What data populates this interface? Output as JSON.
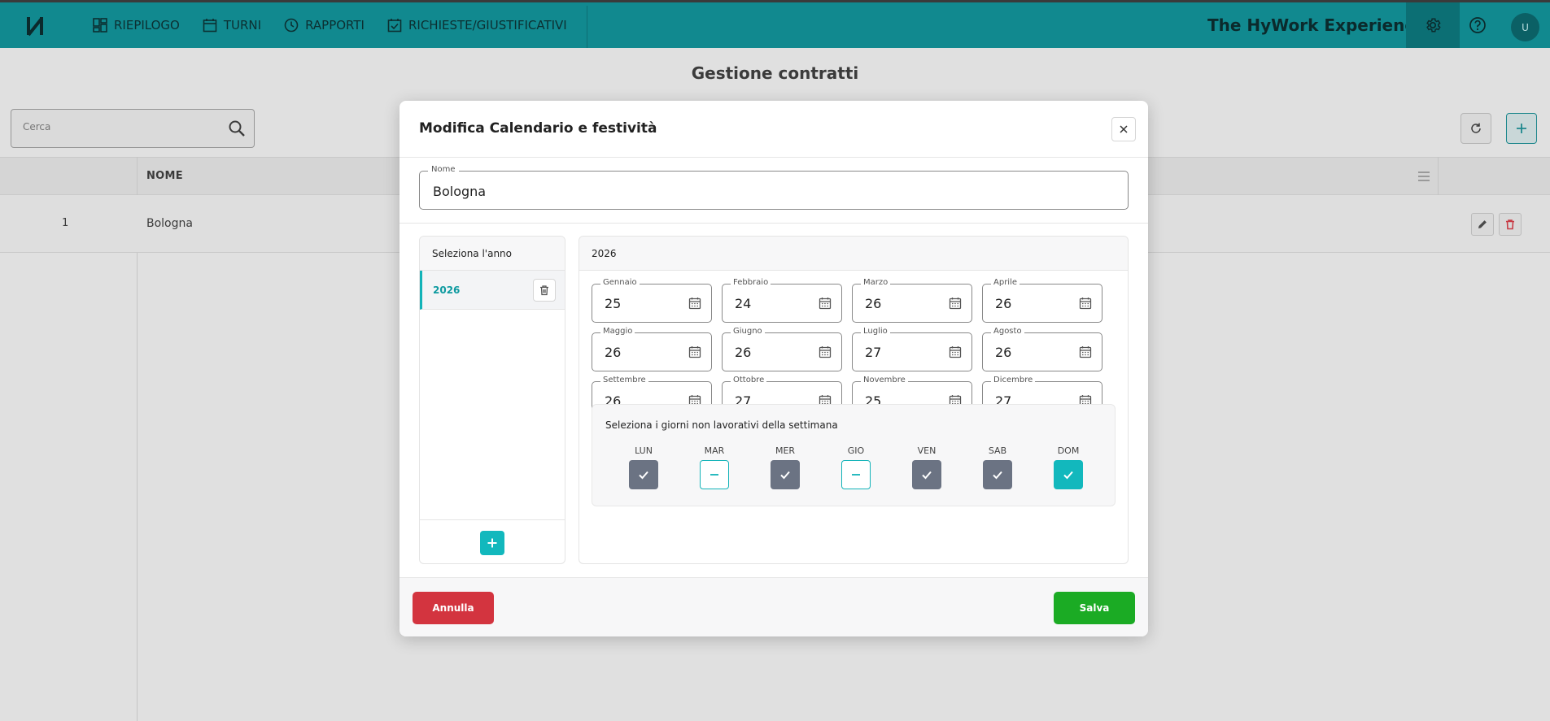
{
  "app": {
    "brand": "The HyWork Experience",
    "avatar_initial": "U",
    "nav": [
      {
        "label": "RIEPILOGO",
        "icon": "dashboard-icon"
      },
      {
        "label": "TURNI",
        "icon": "calendar-icon"
      },
      {
        "label": "RAPPORTI",
        "icon": "clock-icon"
      },
      {
        "label": "RICHIESTE/GIUSTIFICATIVI",
        "icon": "checkbox-calendar-icon"
      }
    ]
  },
  "page": {
    "title": "Gestione contratti",
    "search_placeholder": "Cerca",
    "table": {
      "columns": [
        "",
        "NOME"
      ],
      "rows": [
        {
          "id": "1",
          "name": "Bologna"
        }
      ]
    }
  },
  "modal": {
    "title": "Modifica Calendario e festività",
    "name_label": "Nome",
    "name_value": "Bologna",
    "year_panel_title": "Seleziona l'anno",
    "selected_year": "2026",
    "years": [
      "2026"
    ],
    "months": [
      {
        "label": "Gennaio",
        "value": "25"
      },
      {
        "label": "Febbraio",
        "value": "24"
      },
      {
        "label": "Marzo",
        "value": "26"
      },
      {
        "label": "Aprile",
        "value": "26"
      },
      {
        "label": "Maggio",
        "value": "26"
      },
      {
        "label": "Giugno",
        "value": "26"
      },
      {
        "label": "Luglio",
        "value": "27"
      },
      {
        "label": "Agosto",
        "value": "26"
      },
      {
        "label": "Settembre",
        "value": "26"
      },
      {
        "label": "Ottobre",
        "value": "27"
      },
      {
        "label": "Novembre",
        "value": "25"
      },
      {
        "label": "Dicembre",
        "value": "27"
      }
    ],
    "days_title": "Seleziona i giorni non lavorativi della settimana",
    "days": [
      {
        "label": "LUN",
        "state": "checked"
      },
      {
        "label": "MAR",
        "state": "indeterminate"
      },
      {
        "label": "MER",
        "state": "checked"
      },
      {
        "label": "GIO",
        "state": "indeterminate"
      },
      {
        "label": "VEN",
        "state": "checked"
      },
      {
        "label": "SAB",
        "state": "checked"
      },
      {
        "label": "DOM",
        "state": "checked-accent"
      }
    ],
    "cancel_label": "Annulla",
    "save_label": "Salva"
  },
  "colors": {
    "topbar": "#11898f",
    "accent": "#12b8bd",
    "cancel": "#d3343f",
    "save": "#1bab24",
    "checked": "#6b7383"
  }
}
